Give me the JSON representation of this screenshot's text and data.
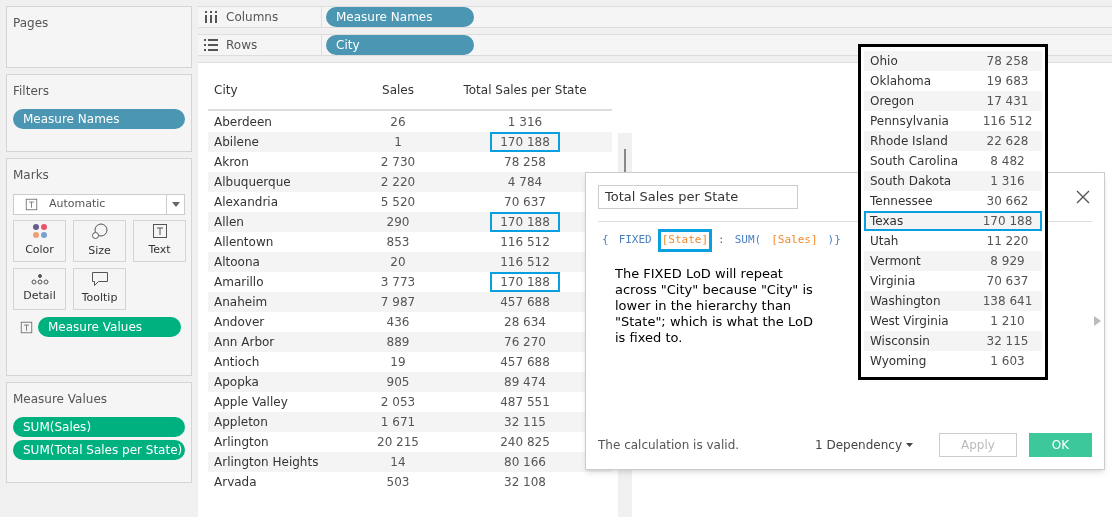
{
  "left_panel": {
    "pages": {
      "title": "Pages"
    },
    "filters": {
      "title": "Filters",
      "pills": [
        "Measure Names"
      ]
    },
    "marks": {
      "title": "Marks",
      "mark_type": "Automatic",
      "cards": [
        {
          "label": "Color",
          "kind": "color"
        },
        {
          "label": "Size",
          "kind": "size"
        },
        {
          "label": "Text",
          "kind": "text"
        },
        {
          "label": "Detail",
          "kind": "detail"
        },
        {
          "label": "Tooltip",
          "kind": "tooltip"
        }
      ],
      "fields": [
        "Measure Values"
      ]
    },
    "measure_values": {
      "title": "Measure Values",
      "pills": [
        "SUM(Sales)",
        "SUM(Total Sales per State)"
      ]
    }
  },
  "shelves": [
    {
      "label": "Columns",
      "kind": "columns",
      "pill": "Measure Names"
    },
    {
      "label": "Rows",
      "kind": "rows",
      "pill": "City"
    }
  ],
  "table": {
    "columns": [
      "City",
      "Sales",
      "Total Sales per State"
    ],
    "rows": [
      {
        "city": "Aberdeen",
        "sales": "26",
        "total": "1 316",
        "highlighted": false
      },
      {
        "city": "Abilene",
        "sales": "1",
        "total": "170 188",
        "highlighted": true
      },
      {
        "city": "Akron",
        "sales": "2 730",
        "total": "78 258",
        "highlighted": false
      },
      {
        "city": "Albuquerque",
        "sales": "2 220",
        "total": "4 784",
        "highlighted": false
      },
      {
        "city": "Alexandria",
        "sales": "5 520",
        "total": "70 637",
        "highlighted": false
      },
      {
        "city": "Allen",
        "sales": "290",
        "total": "170 188",
        "highlighted": true
      },
      {
        "city": "Allentown",
        "sales": "853",
        "total": "116 512",
        "highlighted": false
      },
      {
        "city": "Altoona",
        "sales": "20",
        "total": "116 512",
        "highlighted": false
      },
      {
        "city": "Amarillo",
        "sales": "3 773",
        "total": "170 188",
        "highlighted": true
      },
      {
        "city": "Anaheim",
        "sales": "7 987",
        "total": "457 688",
        "highlighted": false
      },
      {
        "city": "Andover",
        "sales": "436",
        "total": "28 634",
        "highlighted": false
      },
      {
        "city": "Ann Arbor",
        "sales": "889",
        "total": "76 270",
        "highlighted": false
      },
      {
        "city": "Antioch",
        "sales": "19",
        "total": "457 688",
        "highlighted": false
      },
      {
        "city": "Apopka",
        "sales": "905",
        "total": "89 474",
        "highlighted": false
      },
      {
        "city": "Apple Valley",
        "sales": "2 053",
        "total": "487 551",
        "highlighted": false
      },
      {
        "city": "Appleton",
        "sales": "1 671",
        "total": "32 115",
        "highlighted": false
      },
      {
        "city": "Arlington",
        "sales": "20 215",
        "total": "240 825",
        "highlighted": false
      },
      {
        "city": "Arlington Heights",
        "sales": "14",
        "total": "80 166",
        "highlighted": false
      },
      {
        "city": "Arvada",
        "sales": "503",
        "total": "32 108",
        "highlighted": false
      }
    ]
  },
  "calc_dialog": {
    "name": "Total Sales per State",
    "formula": [
      {
        "text": "{",
        "kind": "keyword",
        "highlighted": false
      },
      {
        "text": "FIXED",
        "kind": "keyword",
        "highlighted": false
      },
      {
        "text": "[State]",
        "kind": "field",
        "highlighted": true
      },
      {
        "text": ":",
        "kind": "keyword",
        "highlighted": false
      },
      {
        "text": "SUM(",
        "kind": "keyword",
        "highlighted": false
      },
      {
        "text": "[Sales]",
        "kind": "field",
        "highlighted": false
      },
      {
        "text": ")}",
        "kind": "keyword",
        "highlighted": false
      }
    ],
    "note": "The FIXED LoD will repeat across \"City\" because \"City\" is lower in the hierarchy than \"State\"; which is what the LoD is fixed to.",
    "status": "The calculation is valid.",
    "dependency": "1 Dependency",
    "buttons": [
      {
        "label": "Apply",
        "disabled": true
      },
      {
        "label": "OK",
        "disabled": false
      }
    ]
  },
  "state_list": [
    {
      "state": "Ohio",
      "total": "78 258",
      "highlighted": false
    },
    {
      "state": "Oklahoma",
      "total": "19 683",
      "highlighted": false
    },
    {
      "state": "Oregon",
      "total": "17 431",
      "highlighted": false
    },
    {
      "state": "Pennsylvania",
      "total": "116 512",
      "highlighted": false
    },
    {
      "state": "Rhode Island",
      "total": "22 628",
      "highlighted": false
    },
    {
      "state": "South Carolina",
      "total": "8 482",
      "highlighted": false
    },
    {
      "state": "South Dakota",
      "total": "1 316",
      "highlighted": false
    },
    {
      "state": "Tennessee",
      "total": "30 662",
      "highlighted": false
    },
    {
      "state": "Texas",
      "total": "170 188",
      "highlighted": true
    },
    {
      "state": "Utah",
      "total": "11 220",
      "highlighted": false
    },
    {
      "state": "Vermont",
      "total": "8 929",
      "highlighted": false
    },
    {
      "state": "Virginia",
      "total": "70 637",
      "highlighted": false
    },
    {
      "state": "Washington",
      "total": "138 641",
      "highlighted": false
    },
    {
      "state": "West Virginia",
      "total": "1 210",
      "highlighted": false
    },
    {
      "state": "Wisconsin",
      "total": "32 115",
      "highlighted": false
    },
    {
      "state": "Wyoming",
      "total": "1 603",
      "highlighted": false
    }
  ]
}
